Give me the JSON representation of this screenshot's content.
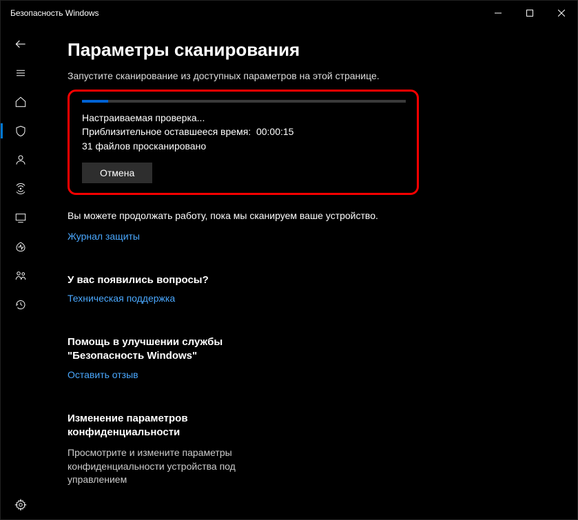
{
  "window": {
    "title": "Безопасность Windows"
  },
  "header": {
    "title": "Параметры сканирования",
    "subtitle": "Запустите сканирование из доступных параметров на этой странице."
  },
  "scan": {
    "status_line": "Настраиваемая проверка...",
    "time_label": "Приблизительное оставшееся время:",
    "time_value": "00:00:15",
    "files_line": "31 файлов просканировано",
    "cancel": "Отмена",
    "progress_percent": 8
  },
  "continue_text": "Вы можете продолжать работу, пока мы сканируем ваше устройство.",
  "history_link": "Журнал защиты",
  "questions": {
    "heading": "У вас появились вопросы?",
    "link": "Техническая поддержка"
  },
  "feedback": {
    "heading": "Помощь в улучшении службы \"Безопасность Windows\"",
    "link": "Оставить отзыв"
  },
  "privacy": {
    "heading": "Изменение параметров конфиденциальности",
    "text": "Просмотрите и измените параметры конфиденциальности устройства под управлением"
  }
}
